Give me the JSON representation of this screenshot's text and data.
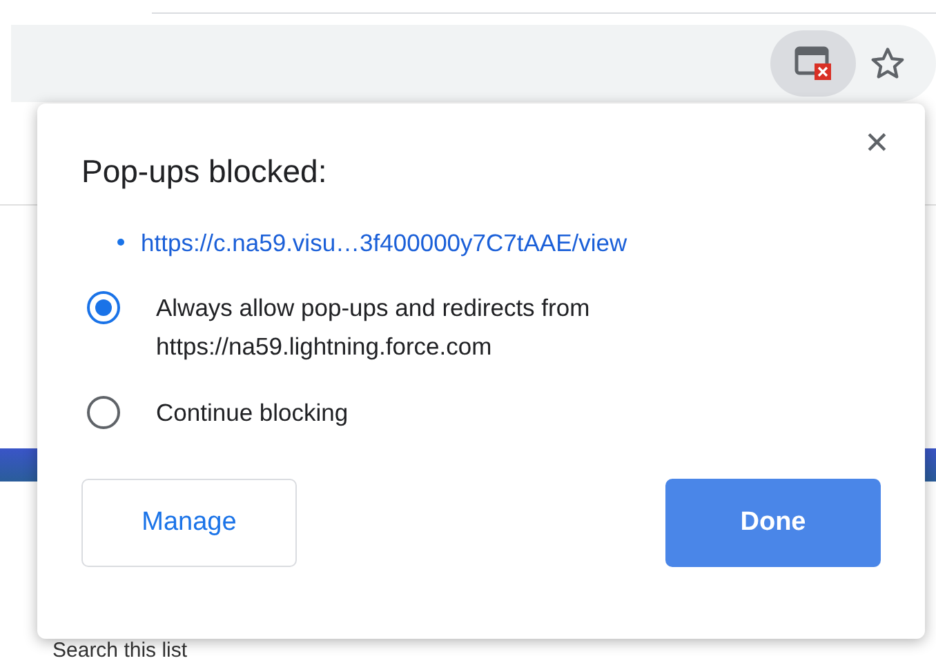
{
  "toolbar": {
    "popup_blocked_active": true
  },
  "popup": {
    "title": "Pop-ups blocked:",
    "close": "✕",
    "blocked_links": [
      "https://c.na59.visu…3f400000y7C7tAAE/view"
    ],
    "options": [
      {
        "label": "Always allow pop-ups and redirects from",
        "detail": "https://na59.lightning.force.com",
        "selected": true
      },
      {
        "label": "Continue blocking",
        "selected": false
      }
    ],
    "buttons": [
      {
        "label": "Manage",
        "kind": "secondary"
      },
      {
        "label": "Done",
        "kind": "primary"
      }
    ]
  },
  "list_search": {
    "placeholder": "Search this list"
  }
}
